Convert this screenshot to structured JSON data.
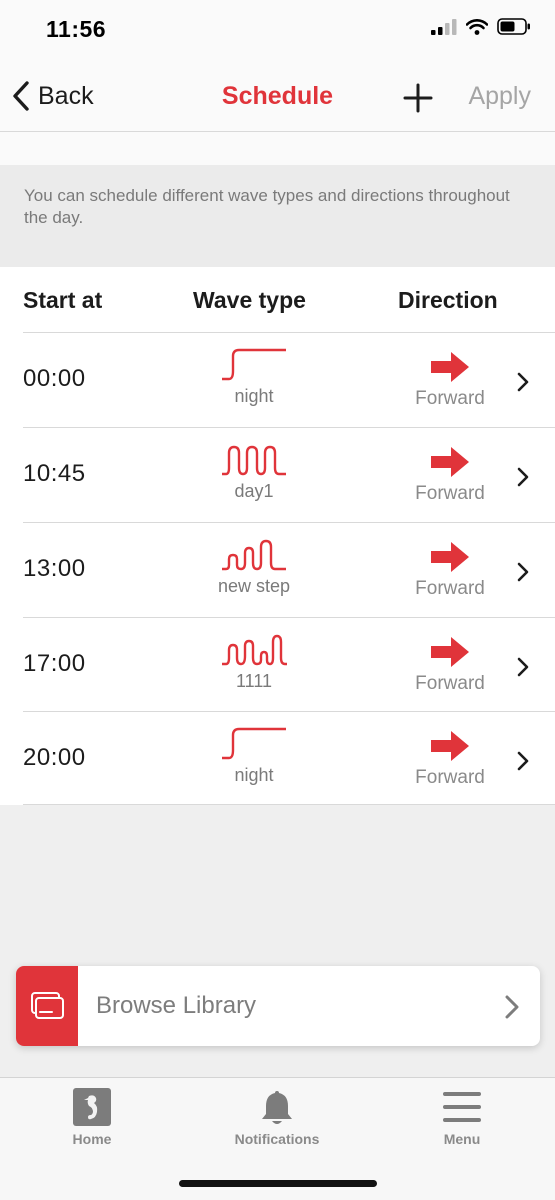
{
  "status_bar": {
    "time": "11:56"
  },
  "nav": {
    "back_label": "Back",
    "title": "Schedule",
    "apply_label": "Apply"
  },
  "info": {
    "text": "You can schedule different wave types and directions throughout the day."
  },
  "table": {
    "headers": {
      "start": "Start at",
      "wave": "Wave type",
      "direction": "Direction"
    },
    "rows": [
      {
        "time": "00:00",
        "wave_icon": "step-wave-icon",
        "wave": "night",
        "direction_icon": "arrow-right-icon",
        "direction": "Forward"
      },
      {
        "time": "10:45",
        "wave_icon": "square-pulse-wave-icon",
        "wave": "day1",
        "direction_icon": "arrow-right-icon",
        "direction": "Forward"
      },
      {
        "time": "13:00",
        "wave_icon": "rising-pulse-wave-icon",
        "wave": "new step",
        "direction_icon": "arrow-right-icon",
        "direction": "Forward"
      },
      {
        "time": "17:00",
        "wave_icon": "irregular-pulse-wave-icon",
        "wave": "1111",
        "direction_icon": "arrow-right-icon",
        "direction": "Forward"
      },
      {
        "time": "20:00",
        "wave_icon": "step-wave-icon",
        "wave": "night",
        "direction_icon": "arrow-right-icon",
        "direction": "Forward"
      }
    ]
  },
  "library": {
    "label": "Browse Library",
    "icon": "library-icon"
  },
  "tabs": [
    {
      "label": "Home",
      "icon": "seahorse-icon"
    },
    {
      "label": "Notifications",
      "icon": "bell-icon"
    },
    {
      "label": "Menu",
      "icon": "hamburger-icon"
    }
  ],
  "colors": {
    "accent": "#e0343a",
    "muted_text": "#7a7a7a",
    "background": "#efefef"
  }
}
